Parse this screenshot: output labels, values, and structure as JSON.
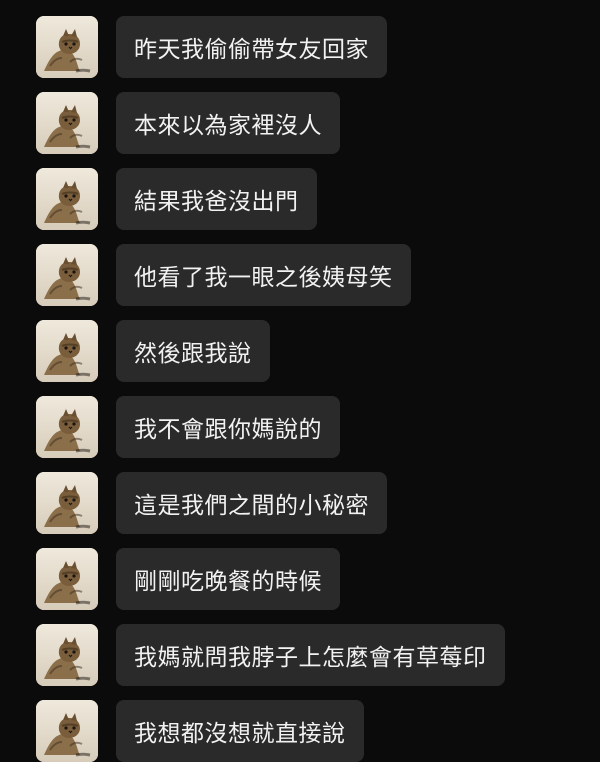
{
  "chat": {
    "messages": [
      {
        "text": "昨天我偷偷帶女友回家"
      },
      {
        "text": "本來以為家裡沒人"
      },
      {
        "text": "結果我爸沒出門"
      },
      {
        "text": "他看了我一眼之後姨母笑"
      },
      {
        "text": "然後跟我說"
      },
      {
        "text": "我不會跟你媽說的"
      },
      {
        "text": "這是我們之間的小秘密"
      },
      {
        "text": "剛剛吃晚餐的時候"
      },
      {
        "text": "我媽就問我脖子上怎麼會有草莓印"
      },
      {
        "text": "我想都沒想就直接說"
      }
    ]
  },
  "theme": {
    "background": "#0b0b0b",
    "bubble": "#2a2a2a",
    "text": "#f2f2f2"
  },
  "avatar_icon": "cat-avatar-icon"
}
